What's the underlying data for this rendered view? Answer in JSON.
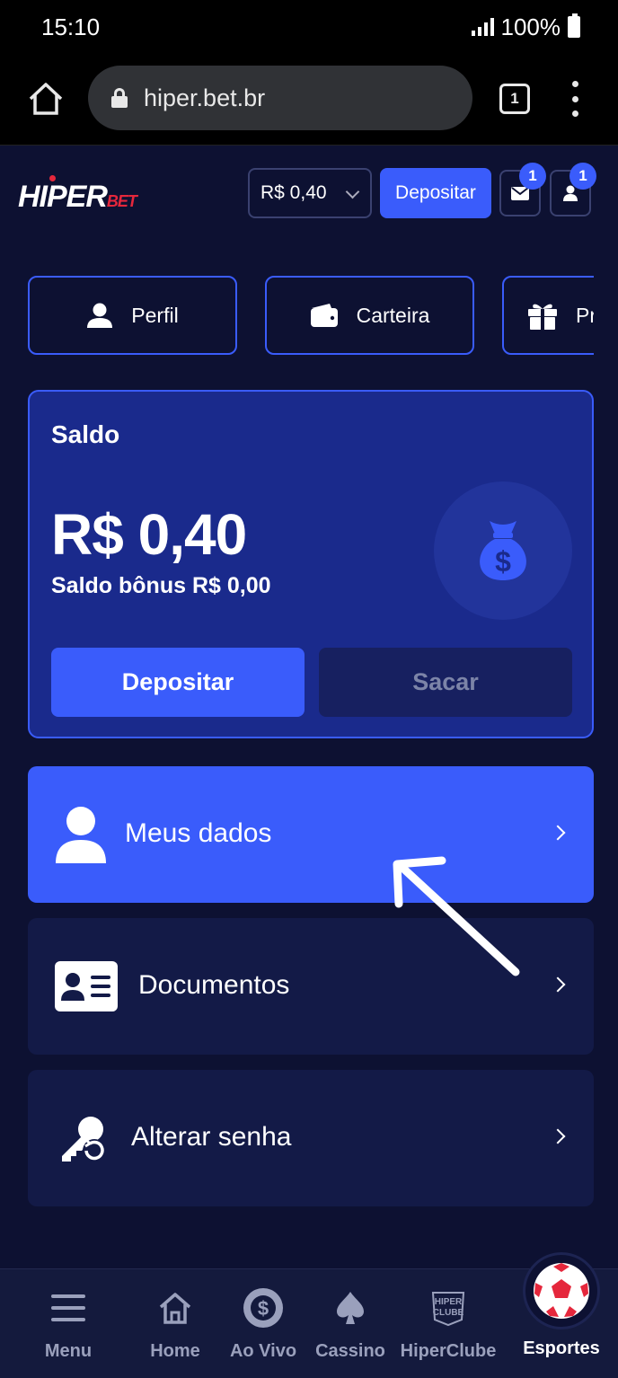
{
  "status_bar": {
    "time": "15:10",
    "battery": "100%"
  },
  "browser": {
    "url": "hiper.bet.br",
    "tab_count": "1"
  },
  "header": {
    "logo_main": "HIPER",
    "logo_sub": "BET",
    "balance": "R$ 0,40",
    "deposit_label": "Depositar",
    "messages_badge": "1",
    "profile_badge": "1"
  },
  "tabs": [
    {
      "label": "Perfil",
      "icon": "user-icon"
    },
    {
      "label": "Carteira",
      "icon": "wallet-icon"
    },
    {
      "label": "Pr",
      "icon": "gift-icon"
    }
  ],
  "saldo": {
    "title": "Saldo",
    "amount": "R$ 0,40",
    "bonus": "Saldo bônus R$ 0,00",
    "deposit_label": "Depositar",
    "withdraw_label": "Sacar"
  },
  "menu": [
    {
      "label": "Meus dados",
      "icon": "user-icon",
      "active": true
    },
    {
      "label": "Documentos",
      "icon": "id-card-icon",
      "active": false
    },
    {
      "label": "Alterar senha",
      "icon": "key-reset-icon",
      "active": false
    }
  ],
  "bottom_nav": [
    {
      "label": "Menu",
      "icon": "hamburger-icon"
    },
    {
      "label": "Home",
      "icon": "house-icon"
    },
    {
      "label": "Ao Vivo",
      "icon": "dollar-coin-icon"
    },
    {
      "label": "Cassino",
      "icon": "spade-icon"
    },
    {
      "label": "HiperClube",
      "icon": "hiperclube-logo-icon",
      "logo_text_1": "HIPER",
      "logo_text_2": "CLUBE"
    },
    {
      "label": "Esportes",
      "icon": "soccer-ball-icon"
    }
  ],
  "colors": {
    "background": "#0d1132",
    "accent": "#3a5cfb",
    "card": "#1a2a8c",
    "brand_red": "#e5273c"
  }
}
